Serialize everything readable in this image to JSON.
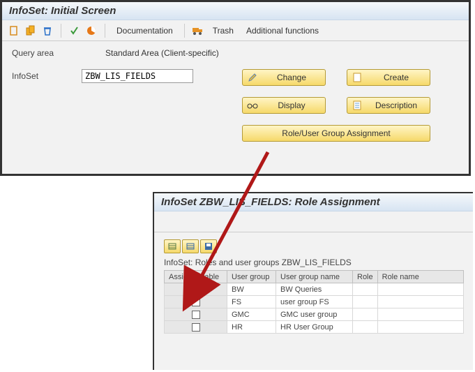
{
  "main": {
    "title": "InfoSet: Initial Screen",
    "toolbar": {
      "doc": "Documentation",
      "trash": "Trash",
      "addl": "Additional functions"
    },
    "query_area_label": "Query area",
    "query_area_value": "Standard Area (Client-specific)",
    "infoset_label": "InfoSet",
    "infoset_value": "ZBW_LIS_FIELDS",
    "buttons": {
      "change": "Change",
      "create": "Create",
      "display": "Display",
      "description": "Description",
      "role_assign": "Role/User Group Assignment"
    }
  },
  "sub": {
    "title": "InfoSet ZBW_LIS_FIELDS: Role Assignment",
    "caption": "InfoSet: Roles and user groups ZBW_LIS_FIELDS",
    "columns": {
      "assigned": "Assigned table",
      "usergroup": "User group",
      "ugname": "User group name",
      "role": "Role",
      "rolename": "Role name"
    },
    "rows": [
      {
        "checked": true,
        "group": "BW",
        "name": "BW Queries"
      },
      {
        "checked": false,
        "group": "FS",
        "name": "user group FS"
      },
      {
        "checked": false,
        "group": "GMC",
        "name": "GMC user group"
      },
      {
        "checked": false,
        "group": "HR",
        "name": "HR User Group"
      }
    ]
  }
}
